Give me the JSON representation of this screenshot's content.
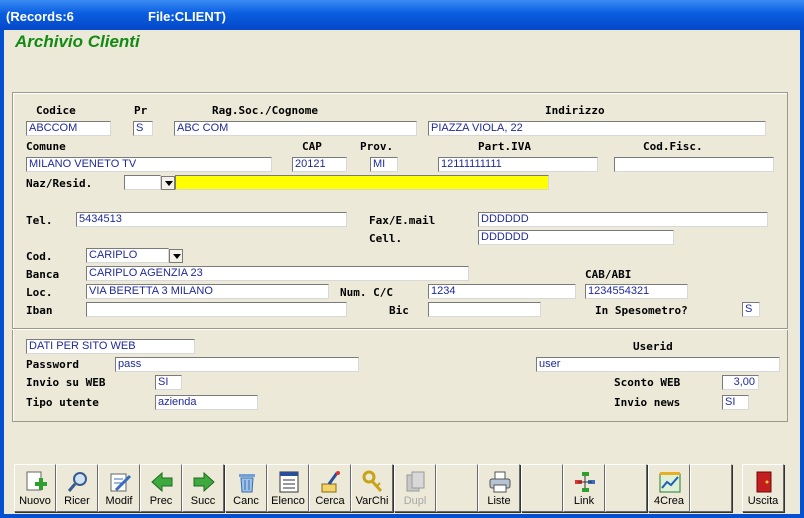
{
  "window": {
    "records_label": "(Records:6",
    "file_label": "File:CLIENT)"
  },
  "form_title": "Archivio Clienti",
  "labels": {
    "codice": "Codice",
    "pr": "Pr",
    "ragsoc": "Rag.Soc./Cognome",
    "indirizzo": "Indirizzo",
    "comune": "Comune",
    "cap": "CAP",
    "prov": "Prov.",
    "partiva": "Part.IVA",
    "codfisc": "Cod.Fisc.",
    "naz": "Naz/Resid.",
    "tel": "Tel.",
    "fax": "Fax/E.mail",
    "cell": "Cell.",
    "cod": "Cod.",
    "banca": "Banca",
    "cababi": "CAB/ABI",
    "loc": "Loc.",
    "numcc": "Num. C/C",
    "iban": "Iban",
    "bic": "Bic",
    "spesometro": "In Spesometro?",
    "password": "Password",
    "userid": "Userid",
    "invio_web": "Invio su WEB",
    "sconto_web": "Sconto WEB",
    "tipo_utente": "Tipo utente",
    "invio_news": "Invio news"
  },
  "fields": {
    "codice": "ABCCOM",
    "pr": "S",
    "ragsoc": "ABC COM",
    "indirizzo": "PIAZZA VIOLA, 22",
    "comune": "MILANO VENETO   TV",
    "cap": "20121",
    "prov": "MI",
    "partiva": "12111111111",
    "codfisc": "",
    "naz": "",
    "naz_desc": "",
    "tel": "5434513",
    "fax": "DDDDDD",
    "cell": "DDDDDD",
    "cod": "CARIPLO",
    "banca": "CARIPLO AGENZIA 23",
    "loc": "VIA BERETTA 3  MILANO",
    "numcc": "1234",
    "cababi": "1234554321",
    "iban": "",
    "bic": "",
    "spesometro": "S",
    "web_header": "DATI PER SITO WEB",
    "password": "pass",
    "userid": "user",
    "invio_web": "SI",
    "sconto_web": "3,00",
    "tipo_utente": "azienda",
    "invio_news": "SI"
  },
  "toolbar": [
    {
      "label": "Nuovo",
      "icon": "new-icon",
      "enabled": true
    },
    {
      "label": "Ricer",
      "icon": "search-icon",
      "enabled": true
    },
    {
      "label": "Modif",
      "icon": "edit-icon",
      "enabled": true
    },
    {
      "label": "Prec",
      "icon": "arrow-left-icon",
      "enabled": true
    },
    {
      "label": "Succ",
      "icon": "arrow-right-icon",
      "enabled": true
    },
    {
      "label": "Canc",
      "icon": "trash-icon",
      "enabled": true
    },
    {
      "label": "Elenco",
      "icon": "list-icon",
      "enabled": true
    },
    {
      "label": "Cerca",
      "icon": "find-icon",
      "enabled": true
    },
    {
      "label": "VarChi",
      "icon": "keys-icon",
      "enabled": true
    },
    {
      "label": "Dupl",
      "icon": "duplicate-icon",
      "enabled": false
    },
    {
      "label": "",
      "icon": "",
      "enabled": false
    },
    {
      "label": "Liste",
      "icon": "printer-icon",
      "enabled": true
    },
    {
      "label": "",
      "icon": "",
      "enabled": false
    },
    {
      "label": "Link",
      "icon": "link-icon",
      "enabled": true
    },
    {
      "label": "",
      "icon": "",
      "enabled": false
    },
    {
      "label": "4Crea",
      "icon": "create-icon",
      "enabled": true
    },
    {
      "label": "",
      "icon": "",
      "enabled": false
    },
    {
      "label": "Uscita",
      "icon": "exit-door-icon",
      "enabled": true
    }
  ],
  "colors": {
    "title_green": "#138A13",
    "field_text": "#1F2A9A",
    "highlight_yellow": "#FFFF00",
    "titlebar_blue": "#0550D0"
  }
}
